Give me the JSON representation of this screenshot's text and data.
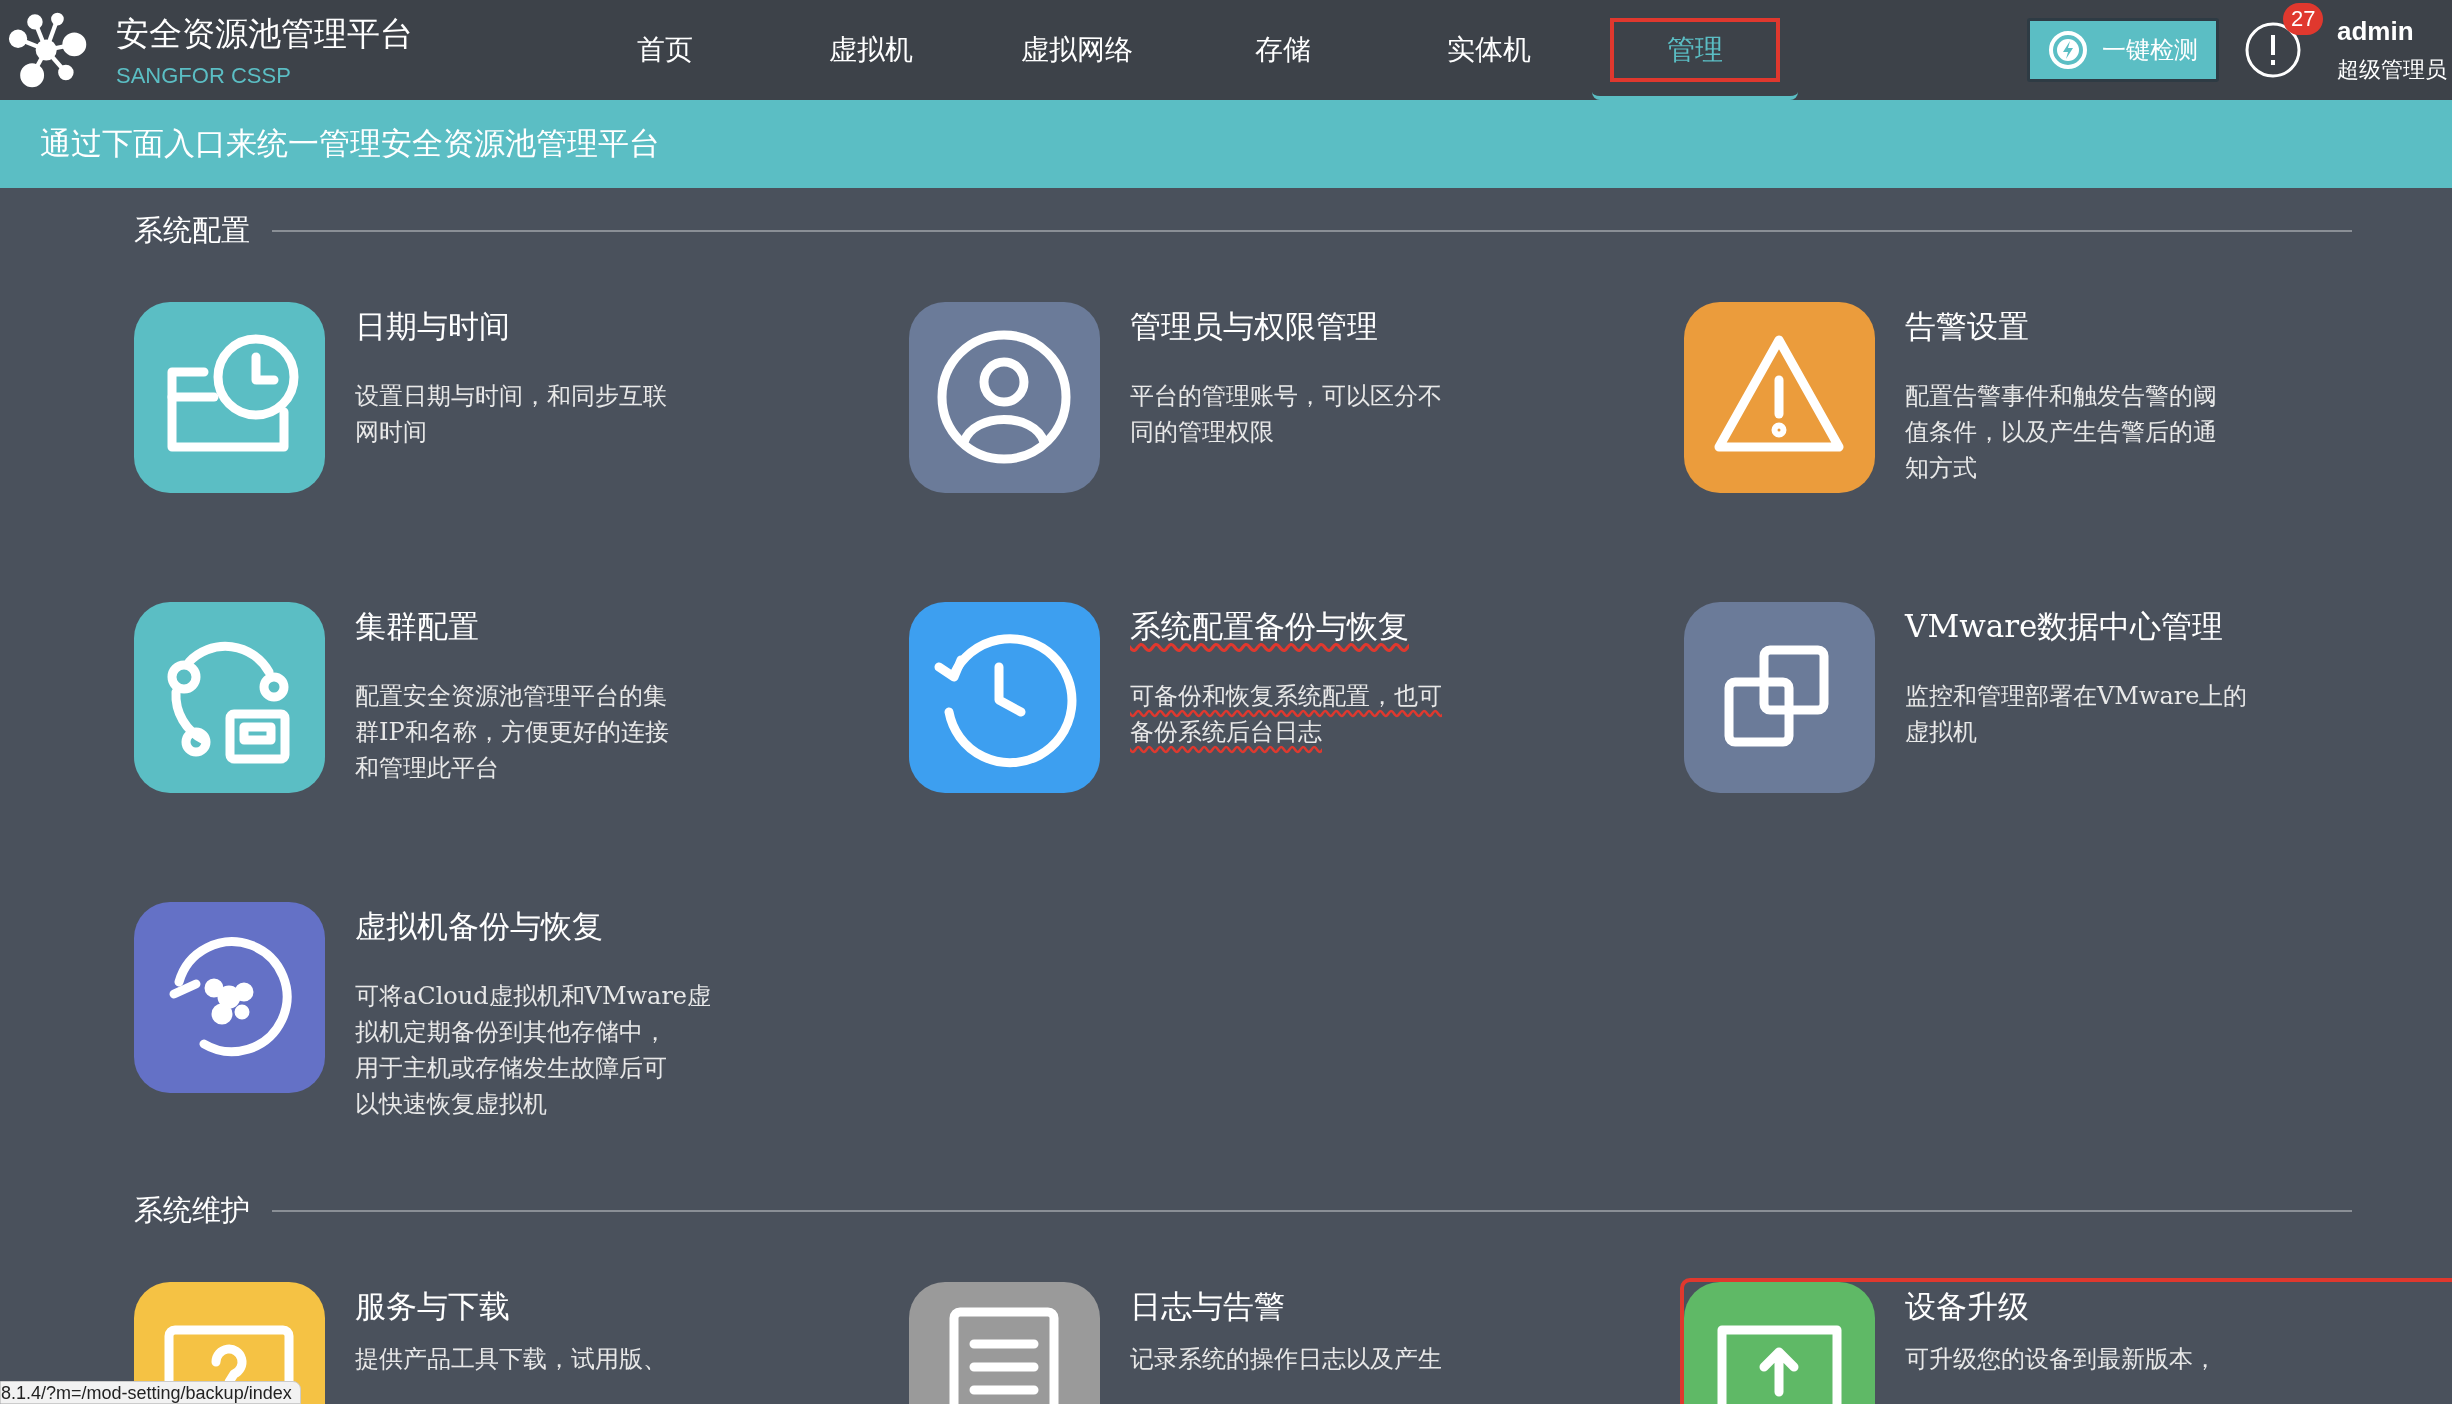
{
  "header": {
    "title": "安全资源池管理平台",
    "subtitle": "SANGFOR CSSP",
    "nav": [
      {
        "label": "首页",
        "selected": false,
        "highlighted": false
      },
      {
        "label": "虚拟机",
        "selected": false,
        "highlighted": false
      },
      {
        "label": "虚拟网络",
        "selected": false,
        "highlighted": false
      },
      {
        "label": "存储",
        "selected": false,
        "highlighted": false
      },
      {
        "label": "实体机",
        "selected": false,
        "highlighted": false
      },
      {
        "label": "管理",
        "selected": true,
        "highlighted": true
      }
    ],
    "check_button": "一键检测",
    "alert_count": "27",
    "user": {
      "name": "admin",
      "role": "超级管理员"
    }
  },
  "banner": "通过下面入口来统一管理安全资源池管理平台",
  "sections": [
    {
      "title": "系统配置",
      "cards": [
        {
          "kind": "calendar",
          "color": "#5bbec4",
          "title": "日期与时间",
          "description_lines": [
            "设置日期与时间，和同步互联",
            "网时间"
          ],
          "hovered": false,
          "highlighted": false
        },
        {
          "kind": "user",
          "color": "#6b7b99",
          "title": "管理员与权限管理",
          "description_lines": [
            "平台的管理账号，可以区分不",
            "同的管理权限"
          ],
          "hovered": false,
          "highlighted": false
        },
        {
          "kind": "warning",
          "color": "#eb9c3c",
          "title": "告警设置",
          "description_lines": [
            "配置告警事件和触发告警的阈",
            "值条件，以及产生告警后的通",
            "知方式"
          ],
          "hovered": false,
          "highlighted": false
        },
        {
          "kind": "cluster",
          "color": "#5bbec4",
          "title": "集群配置",
          "description_lines": [
            "配置安全资源池管理平台的集",
            "群IP和名称，方便更好的连接",
            "和管理此平台"
          ],
          "hovered": false,
          "highlighted": false
        },
        {
          "kind": "history",
          "color": "#3d9ff0",
          "title": "系统配置备份与恢复",
          "description_lines": [
            "可备份和恢复系统配置，也可",
            "备份系统后台日志"
          ],
          "hovered": true,
          "highlighted": false
        },
        {
          "kind": "copy",
          "color": "#6b7b99",
          "title": "VMware数据中心管理",
          "description_lines": [
            "监控和管理部署在VMware上的",
            "虚拟机"
          ],
          "hovered": false,
          "highlighted": false
        },
        {
          "kind": "backup",
          "color": "#6471c6",
          "title": "虚拟机备份与恢复",
          "description_lines": [
            "可将aCloud虚拟机和VMware虚",
            "拟机定期备份到其他存储中，",
            "用于主机或存储发生故障后可",
            "以快速恢复虚拟机"
          ],
          "hovered": false,
          "highlighted": false
        }
      ]
    },
    {
      "title": "系统维护",
      "cards": [
        {
          "kind": "help",
          "color": "#f5c244",
          "title": "服务与下载",
          "description_lines": [
            "提供产品工具下载，试用版、"
          ],
          "hovered": false,
          "highlighted": false
        },
        {
          "kind": "list",
          "color": "#9a9a9a",
          "title": "日志与告警",
          "description_lines": [
            "记录系统的操作日志以及产生"
          ],
          "hovered": false,
          "highlighted": false
        },
        {
          "kind": "upload",
          "color": "#5fb966",
          "title": "设备升级",
          "description_lines": [
            "可升级您的设备到最新版本，"
          ],
          "hovered": false,
          "highlighted": true
        }
      ]
    }
  ],
  "status_url": "8.1.4/?m=/mod-setting/backup/index"
}
